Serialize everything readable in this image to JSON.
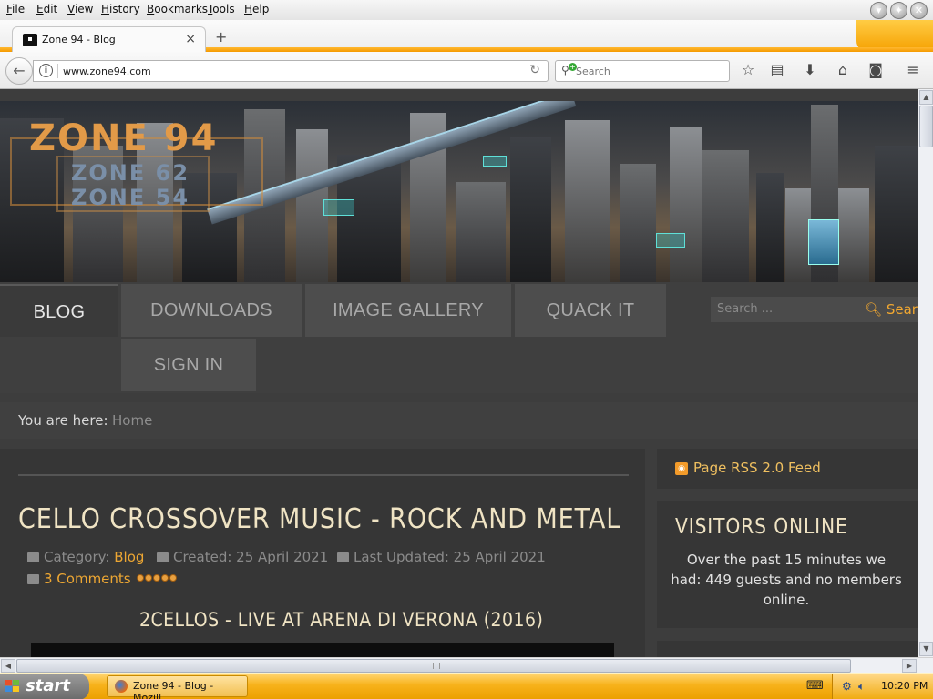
{
  "browser": {
    "menu": [
      "File",
      "Edit",
      "View",
      "History",
      "Bookmarks",
      "Tools",
      "Help"
    ],
    "tab_title": "Zone 94 - Blog",
    "tab_close": "×",
    "new_tab": "+",
    "url": "www.zone94.com",
    "search_placeholder": "Search"
  },
  "site": {
    "logo": "ZONE 94",
    "logo_sub1": "ZONE 62",
    "logo_sub2": "ZONE 54",
    "nav": [
      "BLOG",
      "DOWNLOADS",
      "IMAGE GALLERY",
      "QUACK IT",
      "SIGN IN"
    ],
    "search_placeholder": "Search ...",
    "search_button": "Search",
    "breadcrumb_label": "You are here:",
    "breadcrumb_home": "Home"
  },
  "article": {
    "title": "CELLO CROSSOVER MUSIC - ROCK AND METAL",
    "category_label": "Category:",
    "category": "Blog",
    "created": "Created: 25 April 2021",
    "updated": "Last Updated: 25 April 2021",
    "comments": "3 Comments",
    "rating": 5,
    "subtitle": "2CELLOS - LIVE AT ARENA DI VERONA (2016)"
  },
  "sidebar": {
    "rss": "Page RSS 2.0 Feed",
    "visitors_title": "VISITORS ONLINE",
    "visitors_text": "Over the past 15 minutes we had: 449 guests and no members online."
  },
  "taskbar": {
    "start": "start",
    "task": "Zone 94 - Blog - Mozill...",
    "time": "10:20 PM"
  },
  "colors": {
    "accent": "#eca633",
    "title": "#f0e4c4",
    "taskbar": "#f7b21b"
  }
}
